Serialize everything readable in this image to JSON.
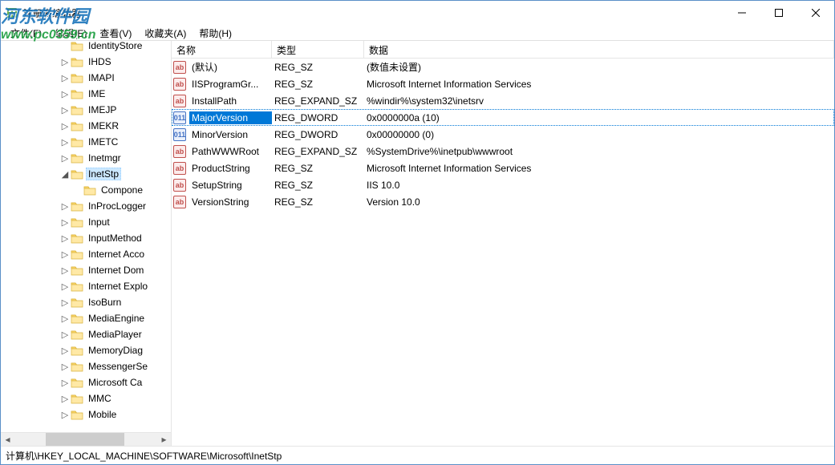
{
  "window": {
    "title": "注册表编辑器"
  },
  "menu": {
    "file": "文件(F)",
    "edit": "编辑(E)",
    "view": "查看(V)",
    "favorites": "收藏夹(A)",
    "help": "帮助(H)"
  },
  "tree": {
    "indent_base": 74,
    "indent_step": 16,
    "items": [
      {
        "depth": 0,
        "expand": "",
        "label": "IdentityStore",
        "cut_left": true
      },
      {
        "depth": 0,
        "expand": ">",
        "label": "IHDS"
      },
      {
        "depth": 0,
        "expand": ">",
        "label": "IMAPI"
      },
      {
        "depth": 0,
        "expand": ">",
        "label": "IME"
      },
      {
        "depth": 0,
        "expand": ">",
        "label": "IMEJP"
      },
      {
        "depth": 0,
        "expand": ">",
        "label": "IMEKR"
      },
      {
        "depth": 0,
        "expand": ">",
        "label": "IMETC"
      },
      {
        "depth": 0,
        "expand": ">",
        "label": "Inetmgr"
      },
      {
        "depth": 0,
        "expand": "v",
        "label": "InetStp",
        "selected": true
      },
      {
        "depth": 1,
        "expand": "",
        "label": "Compone"
      },
      {
        "depth": 0,
        "expand": ">",
        "label": "InProcLogger"
      },
      {
        "depth": 0,
        "expand": ">",
        "label": "Input"
      },
      {
        "depth": 0,
        "expand": ">",
        "label": "InputMethod"
      },
      {
        "depth": 0,
        "expand": ">",
        "label": "Internet Acco"
      },
      {
        "depth": 0,
        "expand": ">",
        "label": "Internet Dom"
      },
      {
        "depth": 0,
        "expand": ">",
        "label": "Internet Explo"
      },
      {
        "depth": 0,
        "expand": ">",
        "label": "IsoBurn"
      },
      {
        "depth": 0,
        "expand": ">",
        "label": "MediaEngine"
      },
      {
        "depth": 0,
        "expand": ">",
        "label": "MediaPlayer"
      },
      {
        "depth": 0,
        "expand": ">",
        "label": "MemoryDiag"
      },
      {
        "depth": 0,
        "expand": ">",
        "label": "MessengerSe"
      },
      {
        "depth": 0,
        "expand": ">",
        "label": "Microsoft Ca"
      },
      {
        "depth": 0,
        "expand": ">",
        "label": "MMC"
      },
      {
        "depth": 0,
        "expand": ">",
        "label": "Mobile"
      }
    ]
  },
  "list": {
    "headers": {
      "name": "名称",
      "type": "类型",
      "data": "数据"
    },
    "rows": [
      {
        "icon": "sz",
        "name": "(默认)",
        "type": "REG_SZ",
        "data": "(数值未设置)"
      },
      {
        "icon": "sz",
        "name": "IISProgramGr...",
        "type": "REG_SZ",
        "data": "Microsoft Internet Information Services"
      },
      {
        "icon": "sz",
        "name": "InstallPath",
        "type": "REG_EXPAND_SZ",
        "data": "%windir%\\system32\\inetsrv"
      },
      {
        "icon": "dw",
        "name": "MajorVersion",
        "type": "REG_DWORD",
        "data": "0x0000000a (10)",
        "selected": true
      },
      {
        "icon": "dw",
        "name": "MinorVersion",
        "type": "REG_DWORD",
        "data": "0x00000000 (0)"
      },
      {
        "icon": "sz",
        "name": "PathWWWRoot",
        "type": "REG_EXPAND_SZ",
        "data": "%SystemDrive%\\inetpub\\wwwroot"
      },
      {
        "icon": "sz",
        "name": "ProductString",
        "type": "REG_SZ",
        "data": "Microsoft Internet Information Services"
      },
      {
        "icon": "sz",
        "name": "SetupString",
        "type": "REG_SZ",
        "data": "IIS 10.0"
      },
      {
        "icon": "sz",
        "name": "VersionString",
        "type": "REG_SZ",
        "data": "Version 10.0"
      }
    ]
  },
  "statusbar": {
    "path": "计算机\\HKEY_LOCAL_MACHINE\\SOFTWARE\\Microsoft\\InetStp"
  },
  "watermark": {
    "site_name": "河东软件园",
    "url": "www.pc0359.cn"
  },
  "scrollbar": {
    "thumb_left_pct": 22,
    "thumb_width_pct": 55
  }
}
